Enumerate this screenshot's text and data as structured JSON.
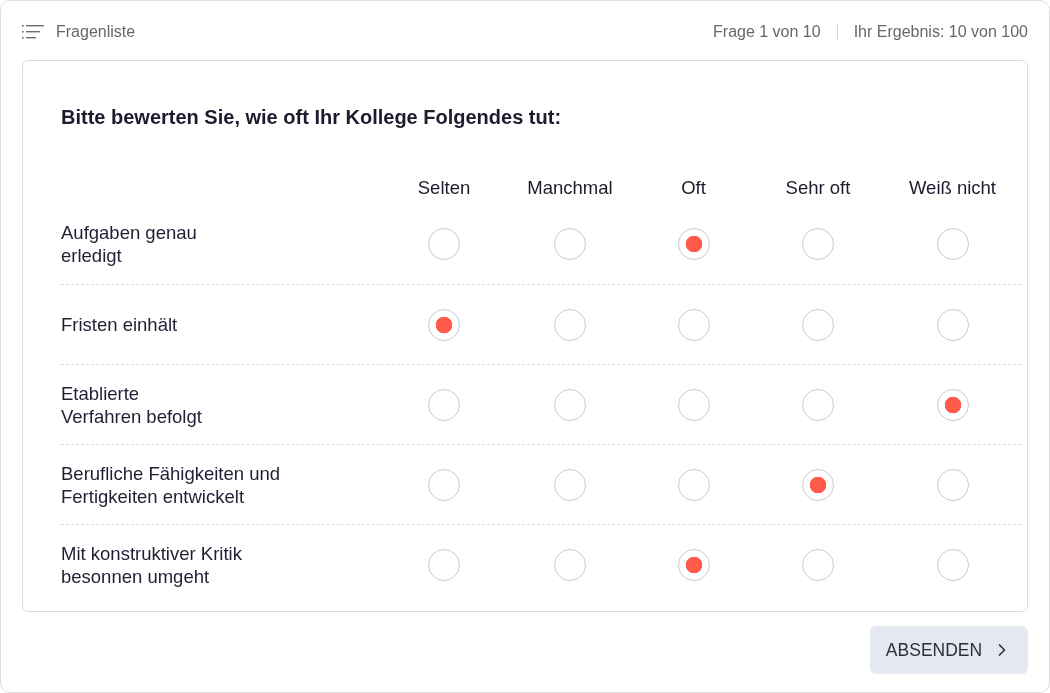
{
  "header": {
    "menu_label": "Fragenliste",
    "progress": "Frage 1 von 10",
    "score": "Ihr Ergebnis: 10 von 100"
  },
  "question": {
    "title": "Bitte bewerten Sie, wie oft Ihr Kollege Folgendes tut:",
    "options": [
      "Selten",
      "Manchmal",
      "Oft",
      "Sehr oft",
      "Weiß nicht"
    ],
    "rows": [
      {
        "label": "Aufgaben genau\nerledigt",
        "choices": [
          {
            "selected": false
          },
          {
            "selected": false
          },
          {
            "selected": true
          },
          {
            "selected": false
          },
          {
            "selected": false
          }
        ]
      },
      {
        "label": "Fristen einhält",
        "choices": [
          {
            "selected": true
          },
          {
            "selected": false
          },
          {
            "selected": false
          },
          {
            "selected": false
          },
          {
            "selected": false
          }
        ]
      },
      {
        "label": "Etablierte\nVerfahren befolgt",
        "choices": [
          {
            "selected": false
          },
          {
            "selected": false
          },
          {
            "selected": false
          },
          {
            "selected": false
          },
          {
            "selected": true
          }
        ]
      },
      {
        "label": "Berufliche Fähigkeiten und\nFertigkeiten entwickelt",
        "choices": [
          {
            "selected": false
          },
          {
            "selected": false
          },
          {
            "selected": false
          },
          {
            "selected": true
          },
          {
            "selected": false
          }
        ]
      },
      {
        "label": "Mit konstruktiver Kritik\nbesonnen umgeht",
        "choices": [
          {
            "selected": false
          },
          {
            "selected": false
          },
          {
            "selected": true
          },
          {
            "selected": false
          },
          {
            "selected": false
          }
        ]
      }
    ]
  },
  "submit_button": {
    "label": "ABSENDEN"
  }
}
